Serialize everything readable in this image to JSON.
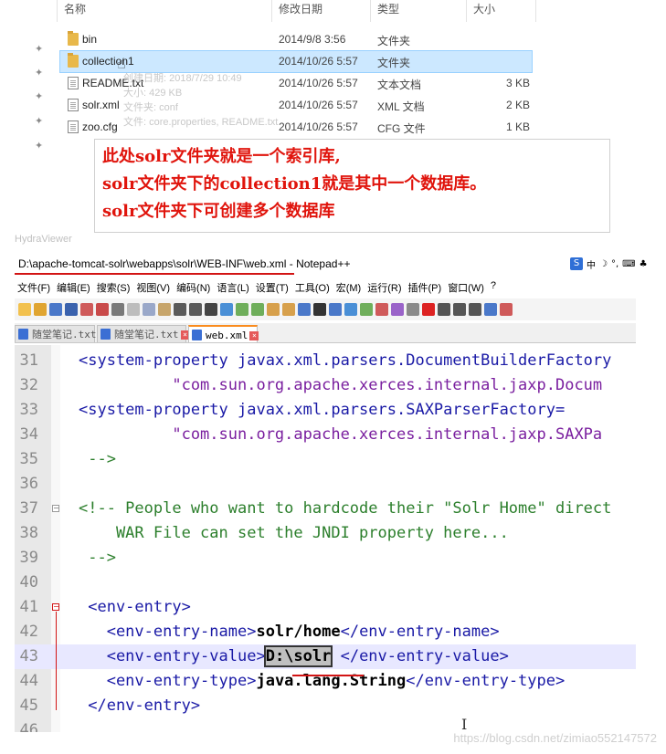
{
  "explorer": {
    "columns": [
      "名称",
      "修改日期",
      "类型",
      "大小"
    ],
    "files": [
      {
        "name": "bin",
        "date": "2014/9/8 3:56",
        "type": "文件夹",
        "size": "",
        "icon": "folder-icon"
      },
      {
        "name": "collection1",
        "date": "2014/10/26 5:57",
        "type": "文件夹",
        "size": "",
        "icon": "folder-icon"
      },
      {
        "name": "README.txt",
        "date": "2014/10/26 5:57",
        "type": "文本文档",
        "size": "3 KB",
        "icon": "text-file-icon"
      },
      {
        "name": "solr.xml",
        "date": "2014/10/26 5:57",
        "type": "XML 文档",
        "size": "2 KB",
        "icon": "xml-file-icon"
      },
      {
        "name": "zoo.cfg",
        "date": "2014/10/26 5:57",
        "type": "CFG 文件",
        "size": "1 KB",
        "icon": "cfg-file-icon"
      }
    ],
    "tooltip_lines": [
      "创建日期: 2018/7/29 10:49",
      "大小: 429 KB",
      "文件夹: conf",
      "文件: core.properties, README.txt"
    ]
  },
  "note": {
    "lines": [
      "此处solr文件夹就是一个索引库,",
      "solr文件夹下的collection1就是其中一个数据库。",
      "solr文件夹下可创建多个数据库"
    ],
    "color": "#e0140c"
  },
  "hydra_label": "HydraViewer",
  "notepad": {
    "title": "D:\\apache-tomcat-solr\\webapps\\solr\\WEB-INF\\web.xml - Notepad++",
    "ime": "中",
    "menu": [
      "文件(F)",
      "编辑(E)",
      "搜索(S)",
      "视图(V)",
      "编码(N)",
      "语言(L)",
      "设置(T)",
      "工具(O)",
      "宏(M)",
      "运行(R)",
      "插件(P)",
      "窗口(W)",
      "?"
    ],
    "tabs": [
      "随堂笔记.txt",
      "随堂笔记.txt",
      "web.xml"
    ],
    "lines": [
      {
        "n": "31",
        "parts": [
          [
            "tag",
            "<system-property javax.xml.parsers.DocumentBuilderFactory"
          ]
        ]
      },
      {
        "n": "32",
        "parts": [
          [
            "str",
            "          \"com.sun.org.apache.xerces.internal.jaxp.Docum"
          ]
        ]
      },
      {
        "n": "33",
        "parts": [
          [
            "tag",
            "<system-property javax.xml.parsers.SAXParserFactory="
          ]
        ]
      },
      {
        "n": "34",
        "parts": [
          [
            "str",
            "          \"com.sun.org.apache.xerces.internal.jaxp.SAXPa"
          ]
        ]
      },
      {
        "n": "35",
        "parts": [
          [
            "cmt",
            " -->"
          ]
        ]
      },
      {
        "n": "36",
        "parts": []
      },
      {
        "n": "37",
        "parts": [
          [
            "cmt",
            "<!-- People who want to hardcode their \"Solr Home\" direct"
          ]
        ]
      },
      {
        "n": "38",
        "parts": [
          [
            "cmt",
            "    WAR File can set the JNDI property here..."
          ]
        ]
      },
      {
        "n": "39",
        "parts": [
          [
            "cmt",
            " -->"
          ]
        ]
      },
      {
        "n": "40",
        "parts": []
      },
      {
        "n": "41",
        "parts": [
          [
            "tag",
            " <env-entry>"
          ]
        ]
      },
      {
        "n": "42",
        "parts": [
          [
            "tag",
            "   <env-entry-name>"
          ],
          [
            "bold",
            "solr/home"
          ],
          [
            "tag",
            "</env-entry-name>"
          ]
        ]
      },
      {
        "n": "43",
        "parts": [
          [
            "tag",
            "   <env-entry-value>"
          ],
          [
            "sel-box",
            "D:\\solr"
          ],
          [
            "tag",
            " </env-entry-value>"
          ]
        ]
      },
      {
        "n": "44",
        "parts": [
          [
            "tag",
            "   <env-entry-type>"
          ],
          [
            "bold",
            "java.lang.String"
          ],
          [
            "tag",
            "</env-entry-type>"
          ]
        ]
      },
      {
        "n": "45",
        "parts": [
          [
            "tag",
            " </env-entry>"
          ]
        ]
      },
      {
        "n": "46",
        "parts": []
      }
    ]
  },
  "watermark": "https://blog.csdn.net/zimiao552147572"
}
